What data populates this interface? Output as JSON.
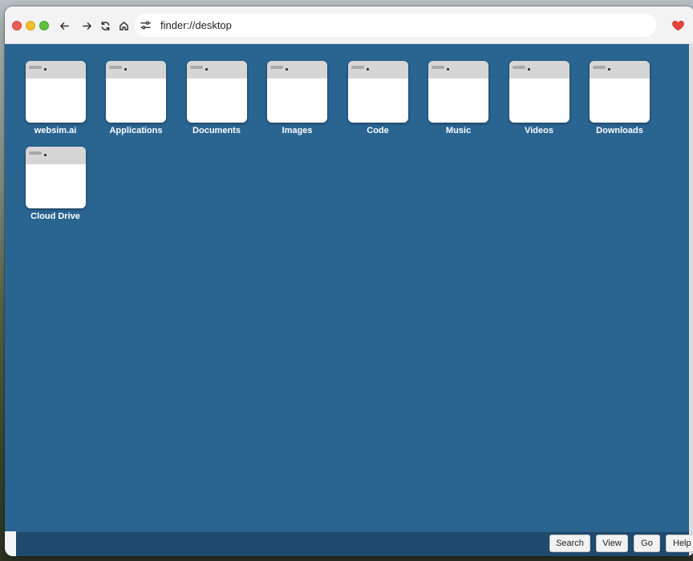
{
  "window": {
    "url": "finder://desktop"
  },
  "icons": {
    "back": "arrow-left-icon",
    "forward": "arrow-right-icon",
    "reload": "refresh-icon",
    "home": "home-icon",
    "site_settings": "tune-icon",
    "favorite": "heart-icon"
  },
  "colors": {
    "desktop_bg": "#2a6491",
    "taskbar_bg": "#1e4a6e",
    "heart": "#e2453c"
  },
  "desktop": {
    "items": [
      {
        "label": "websim.ai"
      },
      {
        "label": "Applications"
      },
      {
        "label": "Documents"
      },
      {
        "label": "Images"
      },
      {
        "label": "Code"
      },
      {
        "label": "Music"
      },
      {
        "label": "Videos"
      },
      {
        "label": "Downloads"
      },
      {
        "label": "Cloud Drive"
      }
    ]
  },
  "taskbar": {
    "search_label": "Search",
    "view_label": "View",
    "go_label": "Go",
    "help_label": "Help"
  }
}
